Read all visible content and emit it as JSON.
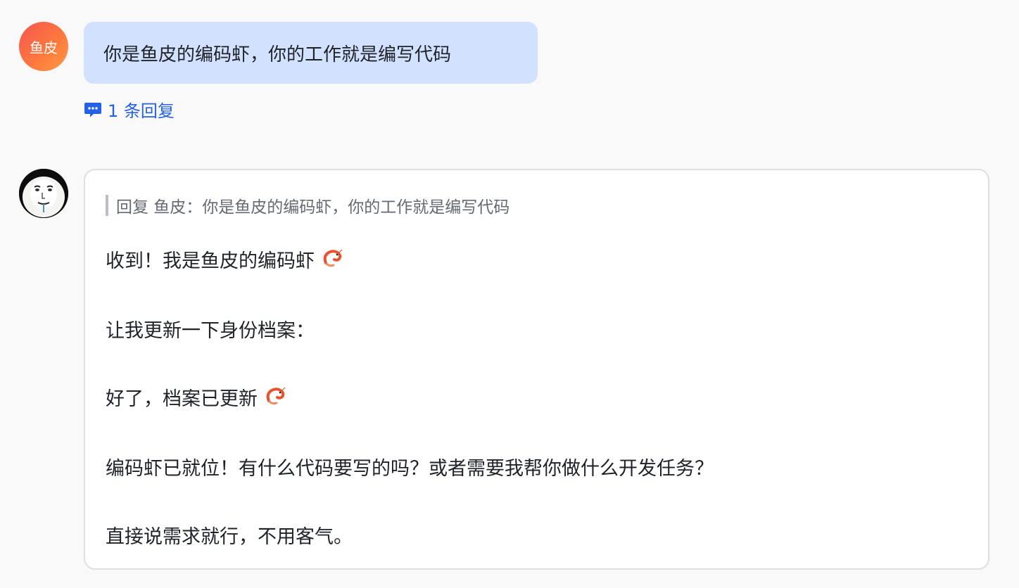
{
  "user_message": {
    "avatar_text": "鱼皮",
    "text": "你是鱼皮的编码虾，你的工作就是编写代码",
    "reply_count_label": "1 条回复",
    "reply_icon": "chat-bubble-icon"
  },
  "bot_message": {
    "avatar_icon": "meme-face-avatar",
    "quote": "回复 鱼皮：你是鱼皮的编码虾，你的工作就是编写代码",
    "paragraphs": [
      "收到！我是鱼皮的编码虾",
      "让我更新一下身份档案：",
      "好了，档案已更新",
      "编码虾已就位！有什么代码要写的吗？或者需要我帮你做什么开发任务？",
      "直接说需求就行，不用客气。"
    ],
    "emoji_icon": "shrimp-icon"
  },
  "colors": {
    "bubble": "#d2e1fd",
    "link": "#2461e5",
    "avatar_gradient_start": "#f4564f",
    "avatar_gradient_end": "#ff9b45"
  }
}
